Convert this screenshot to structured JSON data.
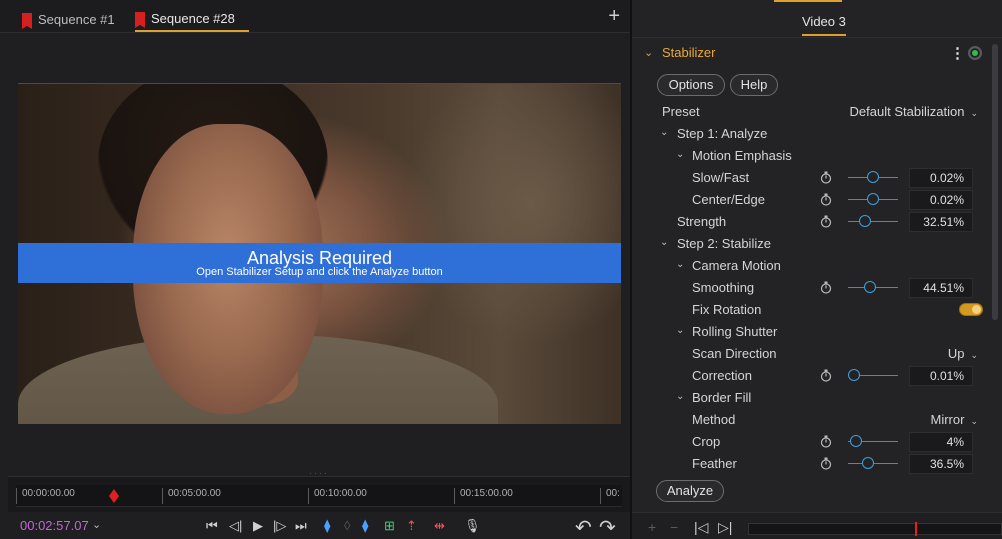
{
  "tabs": [
    {
      "label": "Sequence #1"
    },
    {
      "label": "Sequence #28"
    }
  ],
  "viewer": {
    "banner_title": "Analysis Required",
    "banner_subtitle": "Open Stabilizer Setup and click the Analyze button"
  },
  "timeline": {
    "ticks": [
      "00:00:00.00",
      "00:05:00.00",
      "00:10:00.00",
      "00:15:00.00",
      "00:"
    ],
    "timecode": "00:02:57.07"
  },
  "inspector": {
    "tab_label": "Video 3",
    "section_title": "Stabilizer",
    "options_label": "Options",
    "help_label": "Help",
    "analyze_label": "Analyze",
    "preset_label": "Preset",
    "preset_value": "Default Stabilization",
    "step1_label": "Step 1: Analyze",
    "motion_emphasis_label": "Motion Emphasis",
    "slow_fast": {
      "label": "Slow/Fast",
      "value": "0.02%",
      "level": 0.5
    },
    "center_edge": {
      "label": "Center/Edge",
      "value": "0.02%",
      "level": 0.5
    },
    "strength": {
      "label": "Strength",
      "value": "32.51%",
      "level": 0.3
    },
    "step2_label": "Step 2: Stabilize",
    "camera_motion_label": "Camera Motion",
    "smoothing": {
      "label": "Smoothing",
      "value": "44.51%",
      "level": 0.42
    },
    "fix_rotation_label": "Fix Rotation",
    "fix_rotation_on": true,
    "rolling_shutter_label": "Rolling Shutter",
    "scan_direction_label": "Scan Direction",
    "scan_direction_value": "Up",
    "correction": {
      "label": "Correction",
      "value": "0.01%",
      "level": 0.0
    },
    "border_fill_label": "Border Fill",
    "method_label": "Method",
    "method_value": "Mirror",
    "crop": {
      "label": "Crop",
      "value": "4%",
      "level": 0.04
    },
    "feather": {
      "label": "Feather",
      "value": "36.5%",
      "level": 0.36
    }
  },
  "colors": {
    "accent": "#e0a030",
    "banner": "#2f6fd8",
    "timecode": "#c266d8",
    "playhead": "#e02020",
    "enabled_dot": "#2fbe4e",
    "slider_knob": "#3ea0d8"
  },
  "icons": [
    "plus-icon",
    "flag-icon",
    "chevron-down-icon",
    "keyframe-stopwatch-icon",
    "more-vertical-icon",
    "undo-icon",
    "redo-icon",
    "play-icon",
    "step-back-icon",
    "step-forward-icon",
    "go-to-start-icon",
    "go-to-end-icon",
    "microphone-icon"
  ]
}
